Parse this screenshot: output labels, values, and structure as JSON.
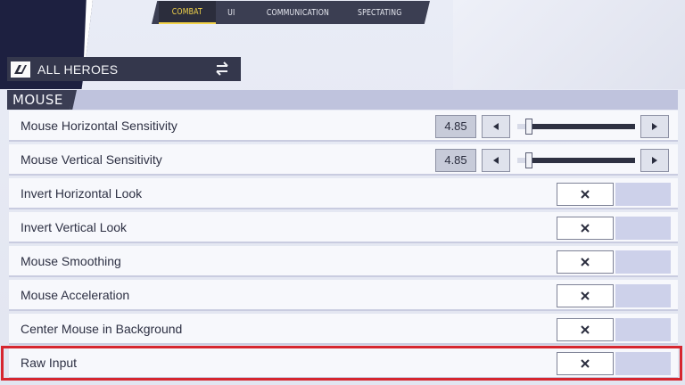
{
  "tabs": [
    {
      "label": "COMBAT",
      "active": true
    },
    {
      "label": "UI",
      "active": false
    },
    {
      "label": "COMMUNICATION",
      "active": false
    },
    {
      "label": "SPECTATING",
      "active": false
    }
  ],
  "hero_selector": {
    "label": "ALL HEROES"
  },
  "section": {
    "title": "MOUSE"
  },
  "settings": {
    "sliders": [
      {
        "label": "Mouse Horizontal Sensitivity",
        "value": "4.85",
        "fraction": 0.1
      },
      {
        "label": "Mouse Vertical Sensitivity",
        "value": "4.85",
        "fraction": 0.1
      }
    ],
    "toggles": [
      {
        "label": "Invert Horizontal Look",
        "state": "off"
      },
      {
        "label": "Invert Vertical Look",
        "state": "off"
      },
      {
        "label": "Mouse Smoothing",
        "state": "off"
      },
      {
        "label": "Mouse Acceleration",
        "state": "off"
      },
      {
        "label": "Center Mouse in Background",
        "state": "off"
      },
      {
        "label": "Raw Input",
        "state": "off",
        "highlighted": true
      }
    ]
  },
  "colors": {
    "accent": "#f2d34a",
    "highlight": "#d6262f",
    "dark": "#34374c",
    "band": "#bfc3dd"
  }
}
